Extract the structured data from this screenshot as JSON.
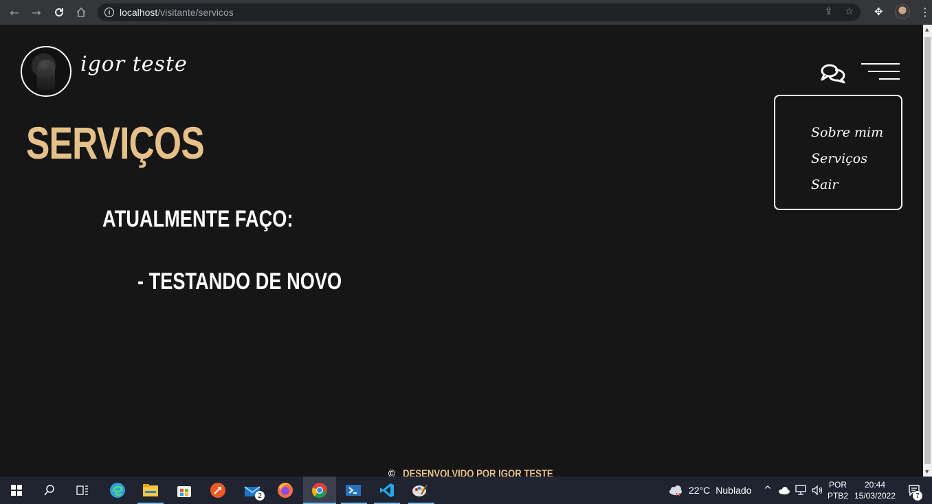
{
  "browser": {
    "url_host": "localhost",
    "url_path": "/visitante/servicos"
  },
  "header": {
    "brand_name": "igor teste"
  },
  "menu": {
    "items": [
      "Sobre mim",
      "Serviços",
      "Sair"
    ]
  },
  "main": {
    "title": "SERVIÇOS",
    "subtitle": "ATUALMENTE FAÇO:",
    "services": [
      "- TESTANDO DE NOVO"
    ]
  },
  "footer": {
    "copyright_symbol": "©",
    "text": "DESENVOLVIDO POR IGOR TESTE"
  },
  "taskbar": {
    "weather_temp": "22°C",
    "weather_desc": "Nublado",
    "lang_top": "POR",
    "lang_bottom": "PTB2",
    "time": "20:44",
    "date": "15/03/2022",
    "mail_badge": "2",
    "notification_badge": "7"
  },
  "icons": [
    "back-icon",
    "forward-icon",
    "reload-icon",
    "home-icon",
    "info-icon",
    "share-icon",
    "star-icon",
    "extensions-icon",
    "profile-avatar",
    "kebab-icon",
    "chat-icon",
    "hamburger-menu-icon"
  ]
}
